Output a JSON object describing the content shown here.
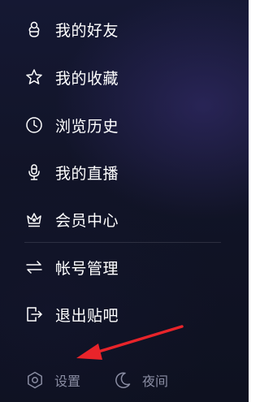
{
  "menu": {
    "items": [
      {
        "label": "我的好友",
        "icon": "friends-icon"
      },
      {
        "label": "我的收藏",
        "icon": "star-icon"
      },
      {
        "label": "浏览历史",
        "icon": "clock-icon"
      },
      {
        "label": "我的直播",
        "icon": "microphone-icon"
      },
      {
        "label": "会员中心",
        "icon": "crown-icon"
      },
      {
        "label": "帐号管理",
        "icon": "switch-arrows-icon"
      },
      {
        "label": "退出贴吧",
        "icon": "exit-icon"
      }
    ]
  },
  "bottom": {
    "settings_label": "设置",
    "night_label": "夜间"
  },
  "colors": {
    "background": "#111427",
    "text": "#ffffff",
    "muted_text": "#8a8da3",
    "annotation_arrow": "#e8242a"
  }
}
